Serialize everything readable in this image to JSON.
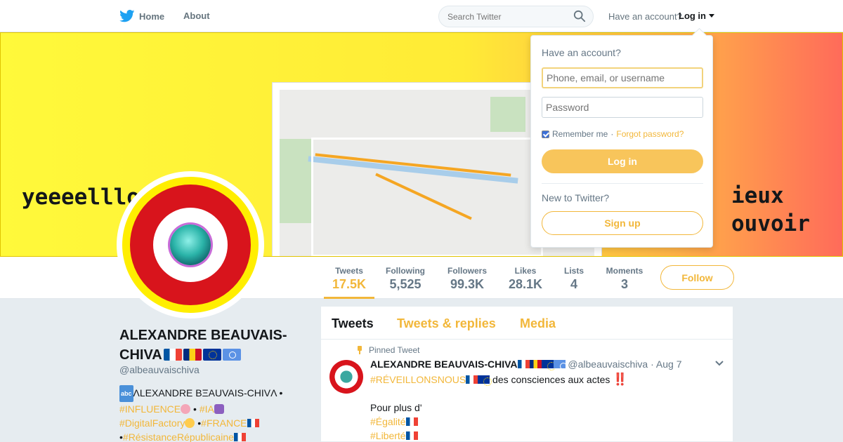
{
  "nav": {
    "home_label": "Home",
    "about_label": "About",
    "search_placeholder": "Search Twitter",
    "have_account": "Have an account?",
    "login_label": "Log in"
  },
  "banner": {
    "left_text": "yeeeelllo",
    "right_text_line1": "ieux",
    "right_text_line2": "ouvoir"
  },
  "stats": [
    {
      "label": "Tweets",
      "value": "17.5K"
    },
    {
      "label": "Following",
      "value": "5,525"
    },
    {
      "label": "Followers",
      "value": "99.3K"
    },
    {
      "label": "Likes",
      "value": "28.1K"
    },
    {
      "label": "Lists",
      "value": "4"
    },
    {
      "label": "Moments",
      "value": "3"
    }
  ],
  "follow_label": "Follow",
  "profile": {
    "name_line1": "ALEXANDRE BEAUVAIS-",
    "name_line2": "CHIVA",
    "handle": "@albeauvaischiva",
    "bio_abc": "abc",
    "bio_name": "ΛLEXANDRE BΞAUVAIS-CHIVΛ •",
    "bio_tag1": "#INFLUENCE",
    "bio_tag2": "#IA",
    "bio_tag3": "#DigitalFactory",
    "bio_tag4": "#FRANCE",
    "bio_tag5": "#RésistanceRépublicaine",
    "bio_bullet": "•"
  },
  "timeline": {
    "tabs": [
      "Tweets",
      "Tweets & replies",
      "Media"
    ],
    "pinned_label": "Pinned Tweet",
    "tweet": {
      "name": "ALEXANDRE BEAUVAIS-CHIVA",
      "handle": "@albeauvaischiva",
      "date": "· Aug 7",
      "line1_tag": "#RÉVEILLONSNOUS",
      "line1_text": " des consciences aux actes ",
      "line1_bang": "‼️",
      "line2": "Pour plus d'",
      "line3_tag": "#Égalité",
      "line4_tag": "#Liberté"
    }
  },
  "login_dropdown": {
    "title": "Have an account?",
    "username_placeholder": "Phone, email, or username",
    "password_placeholder": "Password",
    "remember": "Remember me",
    "separator": "·",
    "forgot": "Forgot password?",
    "login_button": "Log in",
    "new_to_twitter": "New to Twitter?",
    "signup_button": "Sign up"
  },
  "colors": {
    "accent": "#f2b73a",
    "twitter_blue": "#1da1f2",
    "text": "#14171a",
    "muted": "#657786"
  }
}
